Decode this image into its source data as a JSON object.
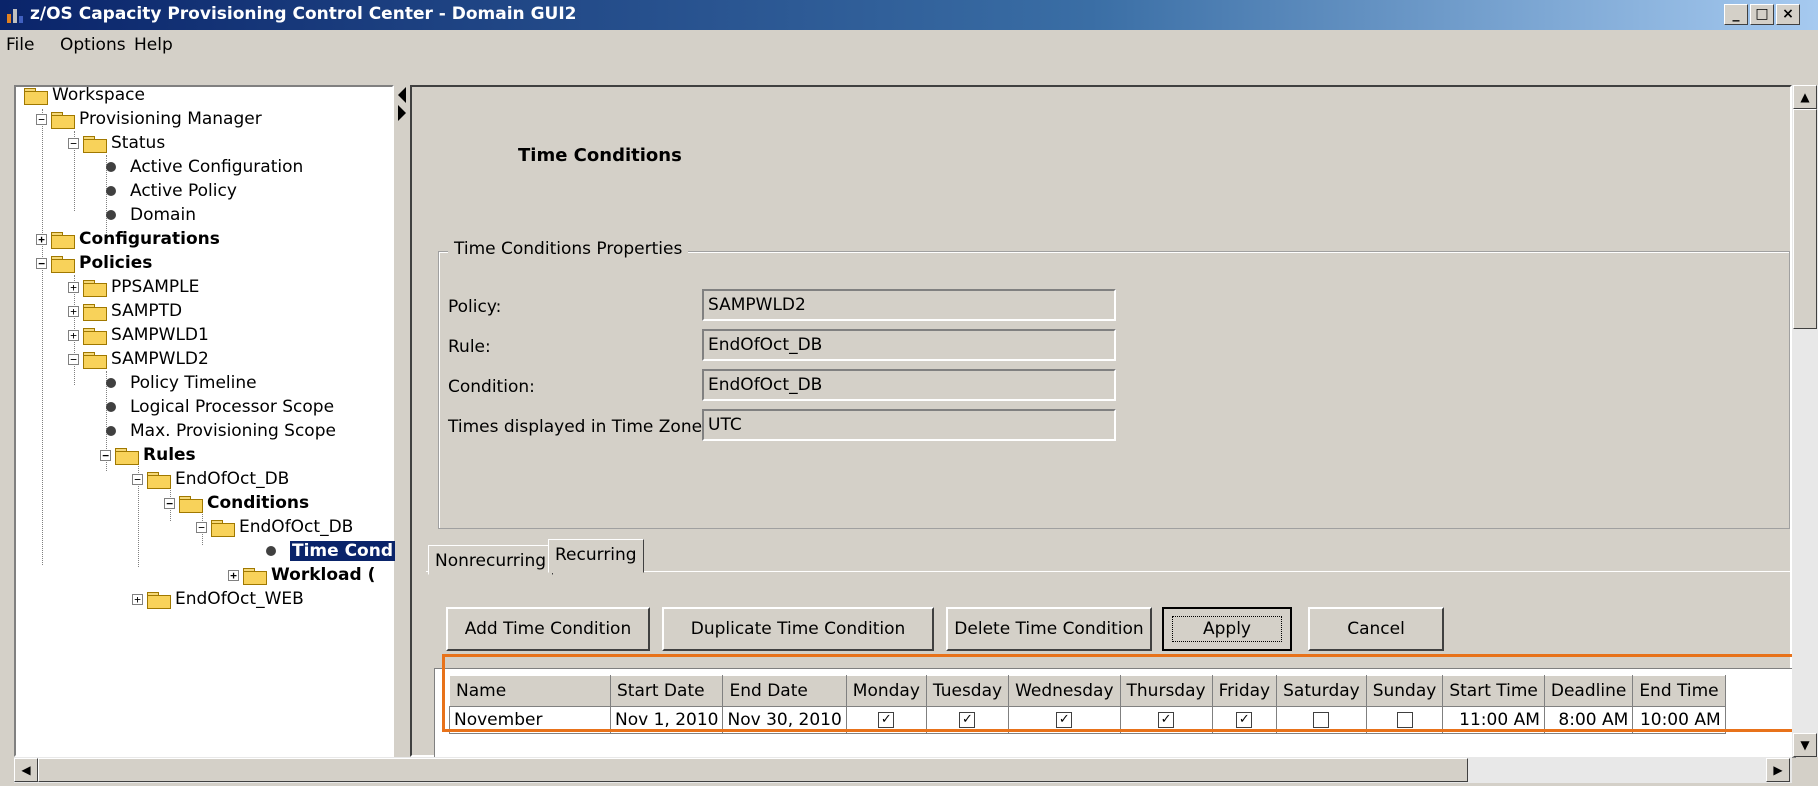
{
  "window": {
    "title": "z/OS Capacity Provisioning Control Center - Domain GUI2"
  },
  "menu": [
    {
      "label": "File"
    },
    {
      "label": "Options"
    },
    {
      "label": "Help"
    }
  ],
  "tree": {
    "workspace": "Workspace",
    "provisioning_manager": "Provisioning Manager",
    "status": "Status",
    "active_configuration": "Active Configuration",
    "active_policy": "Active Policy",
    "domain": "Domain",
    "configurations": "Configurations",
    "policies": "Policies",
    "ppsample": "PPSAMPLE",
    "samptd": "SAMPTD",
    "sampwld1": "SAMPWLD1",
    "sampwld2": "SAMPWLD2",
    "policy_timeline": "Policy Timeline",
    "logical_processor_scope": "Logical Processor Scope",
    "max_provisioning_scope": "Max. Provisioning Scope",
    "rules": "Rules",
    "endofoct_db": "EndOfOct_DB",
    "conditions": "Conditions",
    "endofoct_db_condition": "EndOfOct_DB",
    "time_cond": "Time Cond",
    "workload": "Workload (",
    "endofoct_web": "EndOfOct_WEB"
  },
  "page": {
    "heading": "Time Conditions"
  },
  "properties": {
    "legend": "Time Conditions Properties",
    "policy_label": "Policy:",
    "policy_value": "SAMPWLD2",
    "rule_label": "Rule:",
    "rule_value": "EndOfOct_DB",
    "condition_label": "Condition:",
    "condition_value": "EndOfOct_DB",
    "timezone_label": "Times displayed in Time Zone:",
    "timezone_value": "UTC"
  },
  "tabs": [
    {
      "label": "Nonrecurring",
      "selected": false
    },
    {
      "label": "Recurring",
      "selected": true
    }
  ],
  "buttons": {
    "add": "Add Time Condition",
    "duplicate": "Duplicate Time Condition",
    "delete": "Delete Time Condition",
    "apply": "Apply",
    "cancel": "Cancel"
  },
  "table": {
    "headers": [
      "Name",
      "Start Date",
      "End Date",
      "Monday",
      "Tuesday",
      "Wednesday",
      "Thursday",
      "Friday",
      "Saturday",
      "Sunday",
      "Start Time",
      "Deadline",
      "End Time"
    ],
    "rows": [
      {
        "name": "November",
        "start_date": "Nov 1, 2010",
        "end_date": "Nov 30, 2010",
        "monday": true,
        "tuesday": true,
        "wednesday": true,
        "thursday": true,
        "friday": true,
        "saturday": false,
        "sunday": false,
        "start_time": "11:00 AM",
        "deadline": "8:00 AM",
        "end_time": "10:00 AM"
      }
    ]
  },
  "colors": {
    "highlight": "#e8721a",
    "titlebar": "#0a246a",
    "selection": "#0a246a"
  }
}
